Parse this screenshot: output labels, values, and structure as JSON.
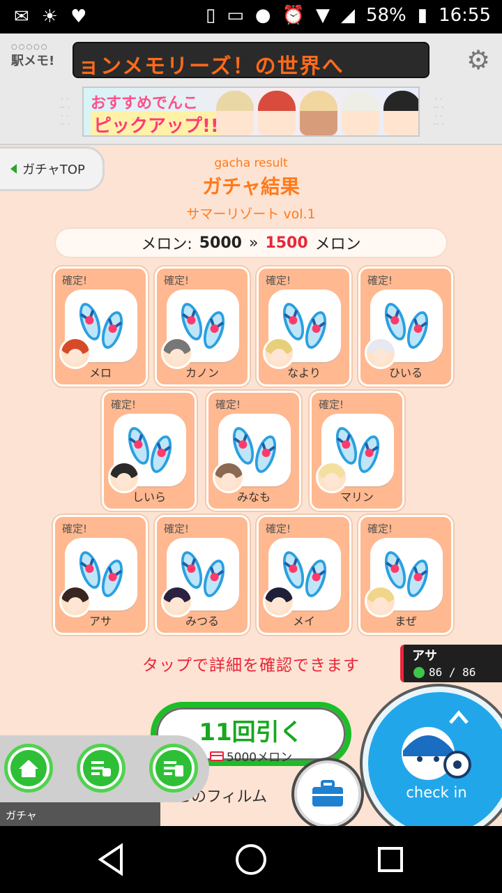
{
  "status": {
    "battery": "58%",
    "time": "16:55"
  },
  "header": {
    "logo": "駅メモ!",
    "ticker": "ョンメモリーズ！の世界へ",
    "banner_line1": "おすすめでんこ",
    "banner_line2": "ピックアップ!!"
  },
  "back": {
    "label": "ガチャTOP"
  },
  "titles": {
    "sub": "gacha result",
    "main": "ガチャ結果",
    "vol": "サマーリゾート vol.1"
  },
  "melon": {
    "label": "メロン:",
    "before": "5000",
    "arrow": "»",
    "after": "1500",
    "unit": "メロン"
  },
  "results": [
    {
      "tag": "確定!",
      "name": "メロ",
      "hair": "#d64a2a"
    },
    {
      "tag": "確定!",
      "name": "カノン",
      "hair": "#777777"
    },
    {
      "tag": "確定!",
      "name": "なより",
      "hair": "#e7d07a"
    },
    {
      "tag": "確定!",
      "name": "ひいる",
      "hair": "#e8e8f0"
    },
    {
      "tag": "確定!",
      "name": "しいら",
      "hair": "#2a2a2a"
    },
    {
      "tag": "確定!",
      "name": "みなも",
      "hair": "#8a6a52"
    },
    {
      "tag": "確定!",
      "name": "マリン",
      "hair": "#f3dfa0"
    },
    {
      "tag": "確定!",
      "name": "アサ",
      "hair": "#3a2620"
    },
    {
      "tag": "確定!",
      "name": "みつる",
      "hair": "#2b2240"
    },
    {
      "tag": "確定!",
      "name": "メイ",
      "hair": "#1f1f3a"
    },
    {
      "tag": "確定!",
      "name": "まぜ",
      "hair": "#f0d58a"
    }
  ],
  "hint": "タップで詳細を確認できます",
  "draw": {
    "label": "11回引く",
    "cost": "5000メロン"
  },
  "film_text": "れこのフィルム",
  "character": {
    "name": "アサ",
    "hp": "86 / 86"
  },
  "checkin": {
    "label": "check in"
  },
  "bottom_nav": {
    "caption": "ガチャ"
  },
  "colors": {
    "accent_orange": "#ff7a1c",
    "green": "#1dbd27",
    "red": "#e8263a",
    "checkin_blue": "#22a6ea"
  }
}
